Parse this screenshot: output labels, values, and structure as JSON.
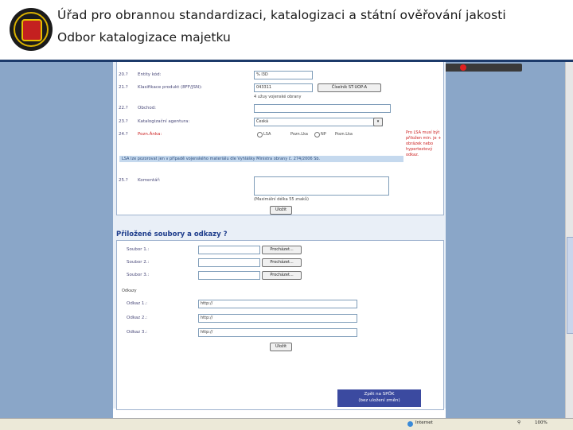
{
  "header": {
    "title_line1": "Úřad pro obrannou standardizaci, katalogizaci a státní ověřování jakosti",
    "title_line2": "Odbor katalogizace majetku"
  },
  "form": {
    "f20": {
      "label": "20.?",
      "name": "Entity kód:",
      "value": "% l3D"
    },
    "f21": {
      "label": "21.?",
      "name": "Klasifikace produkt (8FF/JSN):",
      "value": "043311",
      "button": "Číselník ST-UOP-A",
      "note": "4 užuy vojenské obrany"
    },
    "f22": {
      "label": "22.?",
      "name": "Obchod:"
    },
    "f23": {
      "label": "23.?",
      "name": "Katalogizační agentura:",
      "value": "Česká"
    },
    "f24": {
      "label": "24.?",
      "name": "Pozn.Ánka:",
      "opt1": "LSA",
      "opt2": "Pozn.Lka",
      "opt3": "NP",
      "opt4": "Pozn.Lka"
    },
    "info_bar": "LSA lze pozorovat jen v případě vojenského materiálu dle Vyhlášky Ministra obrany č. 274/2006 Sb.",
    "red_note": "Pro LSA musí být přiložen min. je + obrázek nebo hypertextový odkaz.",
    "f25": {
      "label": "25.?",
      "name": "Komentář:",
      "note": "(Maximální délka 55 znaků)"
    },
    "save": "Uložit"
  },
  "attachments": {
    "title": "Přiložené soubory a odkazy ?",
    "files": [
      {
        "label": "Soubor 1.:",
        "button": "Procházet..."
      },
      {
        "label": "Soubor 2.:",
        "button": "Procházet..."
      },
      {
        "label": "Soubor 3.:",
        "button": "Procházet..."
      }
    ],
    "links_caption": "Odkazy",
    "links": [
      {
        "label": "Odkaz 1.:",
        "value": "http://"
      },
      {
        "label": "Odkaz 2.:",
        "value": "http://"
      },
      {
        "label": "Odkaz 3.:",
        "value": "http://"
      }
    ],
    "save": "Uložit",
    "spok_line1": "Zpět na SPÖK",
    "spok_line2": "(bez uložení změn)"
  },
  "statusbar": {
    "zone": "Internet",
    "zoom": "100%"
  }
}
